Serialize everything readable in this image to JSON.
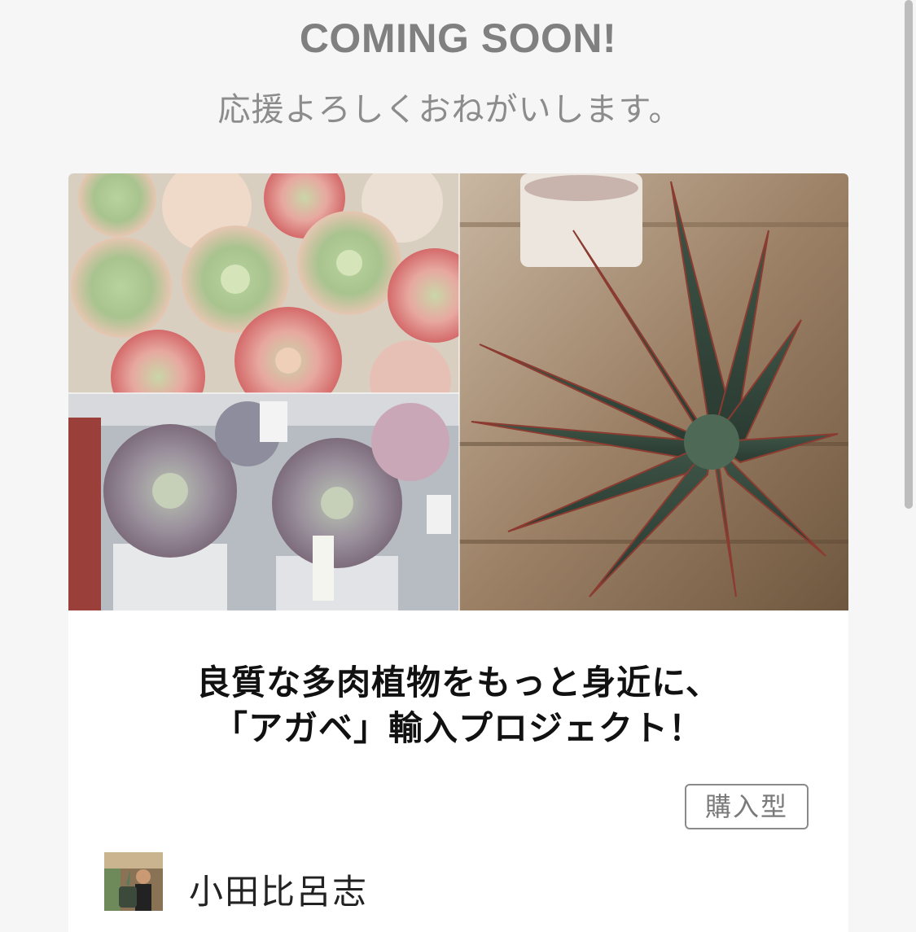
{
  "header": {
    "headline": "COMING SOON!",
    "subline": "応援よろしくおねがいします。"
  },
  "project": {
    "title_line1": "良質な多肉植物をもっと身近に、",
    "title_line2": "「アガベ」輸入プロジェクト！",
    "type_badge": "購入型",
    "owner_name": "小田比呂志",
    "image_icons": [
      "echeveria-photo",
      "agave-photo",
      "succulent-shelf-photo",
      "owner-avatar-photo"
    ]
  },
  "colors": {
    "background": "#f6f6f6",
    "card": "#ffffff",
    "headline_gray": "#808080",
    "title_text": "#111111",
    "badge_border": "#8a8a8a"
  }
}
